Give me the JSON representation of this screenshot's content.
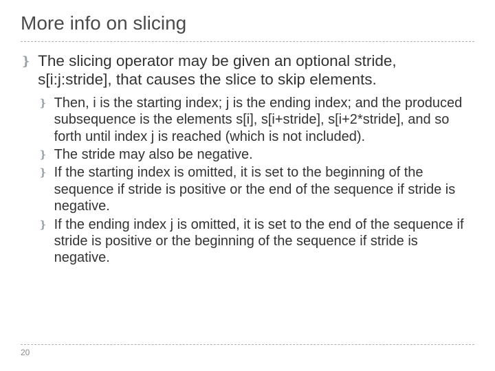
{
  "title": "More info on slicing",
  "bullet_glyph": "❵",
  "level1": {
    "text": "The slicing operator may be given an optional stride, s[i:j:stride], that causes the slice to skip elements."
  },
  "level2": [
    {
      "text": "Then, i is the starting index; j is the ending index; and the produced subsequence is the elements s[i], s[i+stride], s[i+2*stride], and so forth until index j is reached (which is not included)."
    },
    {
      "text": "The stride may also be negative."
    },
    {
      "text": "If the starting index is omitted, it is set to the beginning of the sequence if stride is positive or the end of the sequence if stride is negative."
    },
    {
      "text": "If the ending index j is omitted, it is set to the end of the sequence if stride is positive or the beginning of the sequence if stride is negative."
    }
  ],
  "page_number": "20"
}
